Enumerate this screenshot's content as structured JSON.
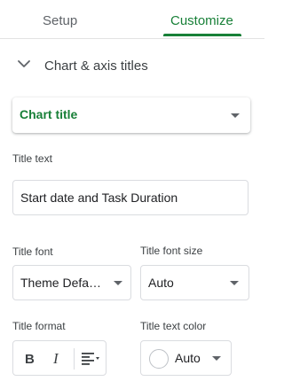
{
  "tabs": {
    "setup": "Setup",
    "customize": "Customize",
    "active": "Customize"
  },
  "section": {
    "title": "Chart & axis titles",
    "expanded": true
  },
  "title_target": {
    "selected": "Chart title"
  },
  "title_text": {
    "label": "Title text",
    "value": "Start date and Task Duration"
  },
  "title_font": {
    "label": "Title font",
    "value": "Theme Defaul..."
  },
  "title_font_size": {
    "label": "Title font size",
    "value": "Auto"
  },
  "title_format": {
    "label": "Title format",
    "bold": "B",
    "italic": "I"
  },
  "title_text_color": {
    "label": "Title text color",
    "value": "Auto"
  },
  "colors": {
    "accent": "#188038",
    "border": "#dadce0",
    "muted_text": "#5f6368"
  },
  "icons": {
    "section_toggle": "chevron-down-icon",
    "bold": "bold-icon",
    "italic": "italic-icon",
    "align": "align-left-icon",
    "dropdown": "caret-down-icon"
  }
}
